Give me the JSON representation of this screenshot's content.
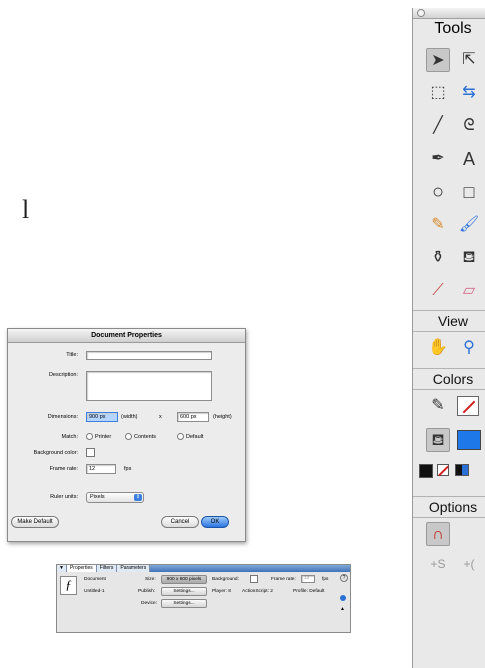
{
  "stray_text": "l",
  "dialog": {
    "title": "Document Properties",
    "title_label": "Title:",
    "title_value": "",
    "description_label": "Description:",
    "description_value": "",
    "dimensions_label": "Dimensions:",
    "width_value": "900 px",
    "width_suffix": "(width)",
    "times": "x",
    "height_value": "600 px",
    "height_suffix": "(height)",
    "match_label": "Match:",
    "match_options": [
      "Printer",
      "Contents",
      "Default"
    ],
    "background_label": "Background color:",
    "frame_rate_label": "Frame rate:",
    "frame_rate_value": "12",
    "fps": "fps",
    "ruler_label": "Ruler units:",
    "ruler_value": "Pixels",
    "make_default": "Make Default",
    "cancel": "Cancel",
    "ok": "OK"
  },
  "inspector": {
    "tabs": [
      "Properties",
      "Filters",
      "Parameters"
    ],
    "doc_type": "Document",
    "doc_name": "Untitled-1",
    "size_label": "Size:",
    "size_value": "900 x 600 pixels",
    "background_label": "Background:",
    "frame_rate_label": "Frame rate:",
    "frame_rate_value": "12",
    "fps": "fps",
    "publish_label": "Publish:",
    "publish_button": "Settings...",
    "player": "Player: 8",
    "actionscript": "ActionScript: 2",
    "profile": "Profile: Default",
    "device_label": "Device:",
    "device_button": "Settings..."
  },
  "tools": {
    "header": "Tools",
    "view": "View",
    "colors": "Colors",
    "options": "Options"
  },
  "colors": {
    "fill": "#1f78e8",
    "stroke": "#d02020",
    "accent": "#3d7fe0"
  }
}
